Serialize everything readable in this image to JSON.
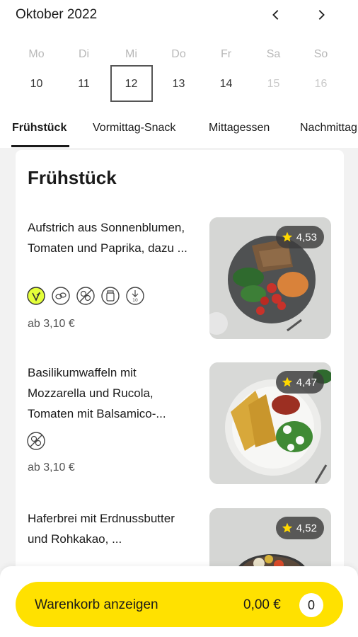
{
  "calendar": {
    "month": "Oktober 2022",
    "days": [
      {
        "name": "Mo",
        "num": "10"
      },
      {
        "name": "Di",
        "num": "11"
      },
      {
        "name": "Mi",
        "num": "12"
      },
      {
        "name": "Do",
        "num": "13"
      },
      {
        "name": "Fr",
        "num": "14"
      },
      {
        "name": "Sa",
        "num": "15"
      },
      {
        "name": "So",
        "num": "16"
      }
    ],
    "selected_day": "12"
  },
  "tabs": [
    "Frühstück",
    "Vormittag-Snack",
    "Mittagessen",
    "Nachmittag"
  ],
  "active_tab": "Frühstück",
  "section": {
    "title": "Frühstück",
    "items": [
      {
        "description": "Aufstrich aus Sonnenblumen, Tomaten und Paprika, dazu ...",
        "icons": [
          "vegan-icon",
          "seed-icon",
          "no-nuts-icon",
          "jar-icon",
          "sugar-icon"
        ],
        "price": "ab 3,10 €",
        "rating": "4,53"
      },
      {
        "description": "Basilikumwaffeln mit Mozzarella und Rucola, Tomaten mit Balsamico-...",
        "icons": [
          "no-nuts-icon"
        ],
        "price": "ab 3,10 €",
        "rating": "4,47"
      },
      {
        "description": "Haferbrei mit Erdnussbutter und Rohkakao, ...",
        "icons": [],
        "price": "",
        "rating": "4,52"
      }
    ]
  },
  "cart": {
    "label": "Warenkorb anzeigen",
    "total": "0,00 €",
    "count": "0"
  },
  "colors": {
    "accent": "#ffe100",
    "vegan_green": "#e4ff3a"
  }
}
